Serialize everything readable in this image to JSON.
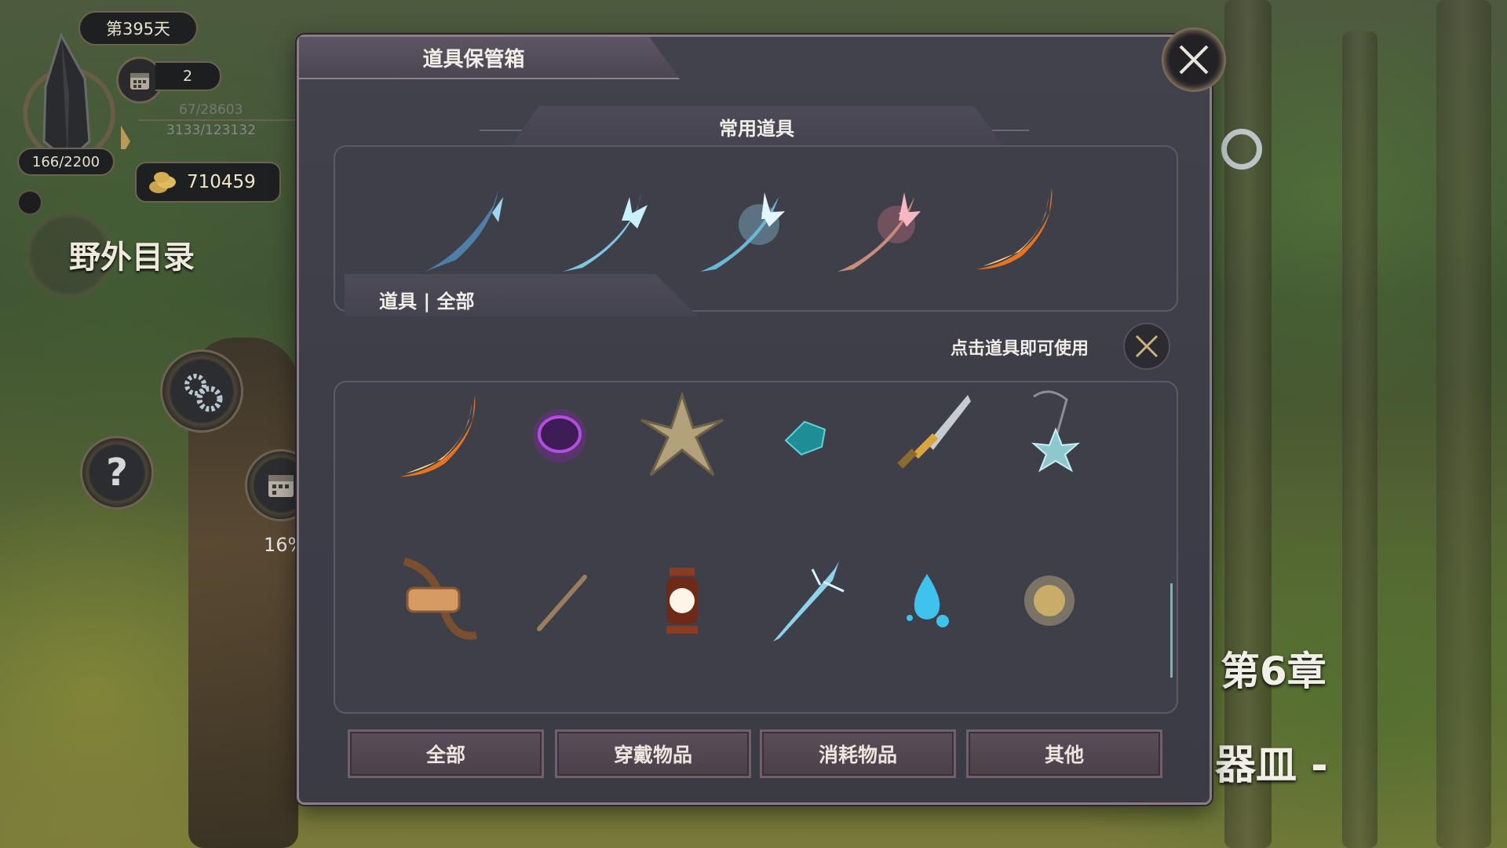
{
  "hud": {
    "day_label": "第395天",
    "calendar_count": "2",
    "crystal_progress": "166/2200",
    "stat_line_1": "67/28603",
    "stat_line_2": "3133/123132",
    "gold": "710459",
    "wild_catalog_label": "野外目录",
    "progress_percent": "16%"
  },
  "background_text": {
    "chapter": "第6章",
    "subtitle_fragment": "器皿 -"
  },
  "panel": {
    "title": "道具保管箱",
    "common_section_title": "常用道具",
    "items_section_title": "道具 | 全部",
    "use_hint": "点击道具即可使用",
    "common_items": [
      {
        "icon": "ice-feather-blade-icon"
      },
      {
        "icon": "frost-wing-blade-icon"
      },
      {
        "icon": "crystal-frost-blade-icon"
      },
      {
        "icon": "crimson-ice-blade-icon"
      },
      {
        "icon": "flame-blade-icon"
      }
    ],
    "items_row1": [
      {
        "icon": "flame-blade-icon"
      },
      {
        "icon": "purple-orb-icon"
      },
      {
        "icon": "wooden-cross-icon"
      },
      {
        "icon": "teal-gem-icon"
      },
      {
        "icon": "golden-sword-icon"
      },
      {
        "icon": "star-amulet-icon"
      }
    ],
    "items_row2": [
      {
        "icon": "leather-belt-icon"
      },
      {
        "icon": "wooden-stick-icon"
      },
      {
        "icon": "lantern-icon"
      },
      {
        "icon": "ice-blade-icon"
      },
      {
        "icon": "water-drop-icon"
      },
      {
        "icon": "golden-dust-icon"
      }
    ],
    "tabs": [
      {
        "label": "全部"
      },
      {
        "label": "穿戴物品"
      },
      {
        "label": "消耗物品"
      },
      {
        "label": "其他"
      }
    ]
  }
}
